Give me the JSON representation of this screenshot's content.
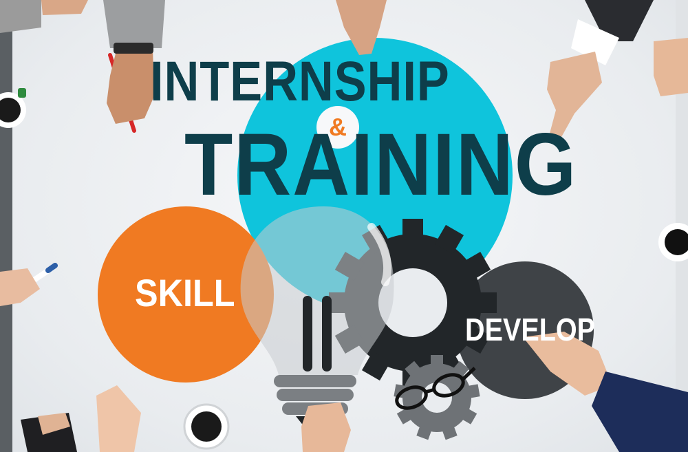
{
  "headline": {
    "line1": "INTERNSHIP",
    "ampersand": "&",
    "line2": "TRAINING"
  },
  "bubbles": {
    "skill": "SKILL",
    "develop": "DEVELOP"
  },
  "colors": {
    "headline": "#0e3e4a",
    "cyan_bubble": "#0fc4dc",
    "orange_bubble": "#f07a22",
    "gray_bubble": "#3f4347",
    "ampersand": "#f07a22",
    "gear": "#222629",
    "bulb_base": "#7b7f83"
  },
  "objects": [
    "coffee-cup",
    "eyeglasses",
    "pen",
    "lightbulb",
    "gears",
    "hands"
  ]
}
